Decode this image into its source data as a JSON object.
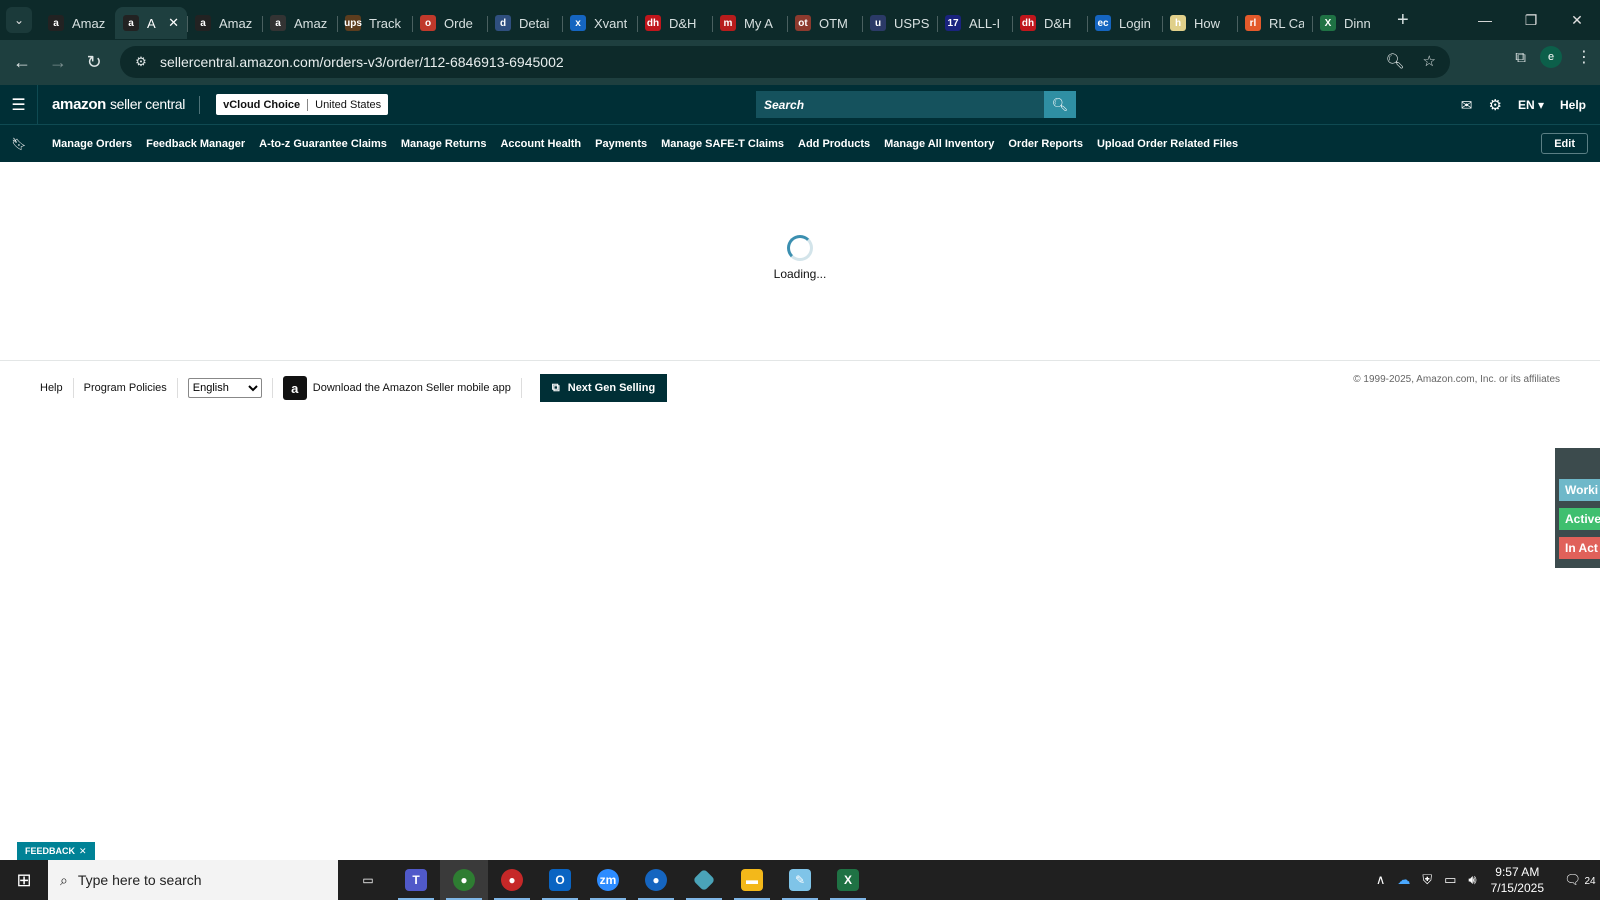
{
  "browser": {
    "tabs": [
      {
        "label": "Amaz",
        "icon": "a",
        "color": "#222"
      },
      {
        "label": "A",
        "icon": "a",
        "color": "#222",
        "active": true
      },
      {
        "label": "Amaz",
        "icon": "a",
        "color": "#222"
      },
      {
        "label": "Amaz",
        "icon": "a",
        "color": "#333"
      },
      {
        "label": "Track",
        "icon": "ups",
        "color": "#5c3d1e"
      },
      {
        "label": "Orde",
        "icon": "o",
        "color": "#c0392b"
      },
      {
        "label": "Detai",
        "icon": "d",
        "color": "#2f4f7f"
      },
      {
        "label": "Xvant",
        "icon": "x",
        "color": "#1565c0"
      },
      {
        "label": "D&H",
        "icon": "dh",
        "color": "#c0161c"
      },
      {
        "label": "My A",
        "icon": "m",
        "color": "#b71c1c"
      },
      {
        "label": "OTM",
        "icon": "ot",
        "color": "#8d3a2e"
      },
      {
        "label": "USPS",
        "icon": "u",
        "color": "#2b3a67"
      },
      {
        "label": "ALL-I",
        "icon": "17",
        "color": "#1a237e"
      },
      {
        "label": "D&H",
        "icon": "dh",
        "color": "#c0161c"
      },
      {
        "label": "Login",
        "icon": "ec",
        "color": "#1565c0"
      },
      {
        "label": "How",
        "icon": "h",
        "color": "#e0d08a"
      },
      {
        "label": "RL Ca",
        "icon": "rl",
        "color": "#e35a2b"
      },
      {
        "label": "Dinn",
        "icon": "X",
        "color": "#1f7244"
      }
    ],
    "close_glyph": "✕",
    "new_tab_glyph": "+",
    "url": "sellercentral.amazon.com/orders-v3/order/112-6846913-6945002",
    "profile_initial": "e"
  },
  "header": {
    "logo_main": "amazon",
    "logo_sub": "seller central",
    "store_name": "vCloud Choice",
    "marketplace": "United States",
    "search_placeholder": "Search",
    "language": "EN",
    "help": "Help"
  },
  "nav": {
    "items": [
      "Manage Orders",
      "Feedback Manager",
      "A-to-z Guarantee Claims",
      "Manage Returns",
      "Account Health",
      "Payments",
      "Manage SAFE-T Claims",
      "Add Products",
      "Manage All Inventory",
      "Order Reports",
      "Upload Order Related Files"
    ],
    "edit_label": "Edit"
  },
  "main": {
    "loading_text": "Loading..."
  },
  "footer": {
    "help": "Help",
    "policies": "Program Policies",
    "language_selected": "English",
    "app_download": "Download the Amazon Seller mobile app",
    "next_gen": "Next Gen Selling",
    "copyright": "© 1999-2025, Amazon.com, Inc. or its affiliates"
  },
  "side_widget": {
    "items": [
      {
        "label": "Worki",
        "color": "#6fb8c9"
      },
      {
        "label": "Active",
        "color": "#3fbf6f"
      },
      {
        "label": "In Act",
        "color": "#e0615a"
      }
    ]
  },
  "feedback_label": "FEEDBACK",
  "taskbar": {
    "search_placeholder": "Type here to search",
    "time": "9:57 AM",
    "date": "7/15/2025",
    "notification_count": "24"
  }
}
